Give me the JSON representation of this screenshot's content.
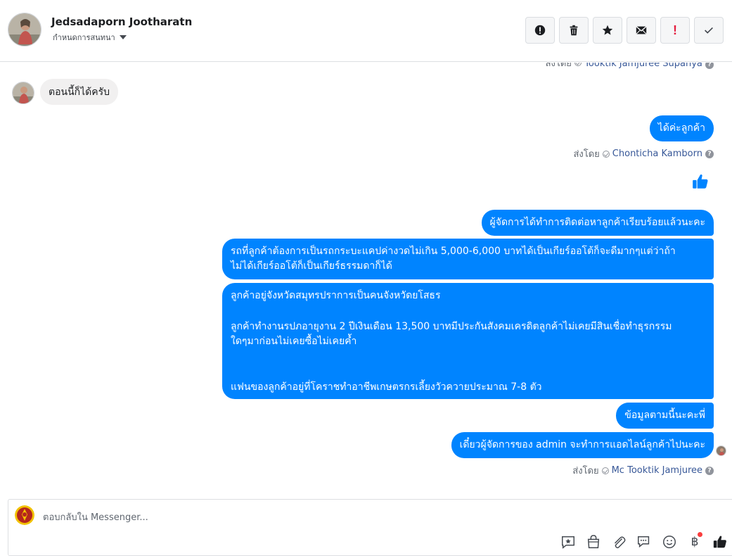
{
  "header": {
    "name": "Jedsadaporn Jootharatn",
    "assign_label": "กำหนดการสนทนา",
    "toolbar_icons": [
      "alert-circle-icon",
      "trash-icon",
      "star-icon",
      "envelope-icon",
      "exclamation-icon",
      "checkmark-icon"
    ]
  },
  "thread": {
    "cutoff_prefix": "ส่งโดย",
    "cutoff_name": "Tooktik Jamjuree Supanya",
    "incoming": "ตอนนี้ก็ได้ครับ",
    "reply1": "ได้ค่ะลูกค้า",
    "sentby_prefix": "ส่งโดย",
    "sentby1_name": "Chonticha Kamborn",
    "msg1": "ผู้จัดการได้ทำการติดต่อหาลูกค้าเรียบร้อยแล้วนะคะ",
    "msg2_l1": "รถที่ลูกค้าต้องการเป็นรถกระบะแคปค่างวดไม่เกิน 5,000-6,000 บาทได้เป็นเกียร์ออโต้ก็จะดีมากๆแต่ว่าถ้า",
    "msg2_l2": "ไม่ได้เกียร์ออโต้ก็เป็นเกียร์ธรรมดาก็ได้",
    "msg3_l1": "ลูกค้าอยู่จังหวัดสมุทรปราการเป็นคนจังหวัดยโสธร",
    "msg3_l2": "ลูกค้าทำงานรปภอายุงาน 2 ปีเงินเดือน 13,500 บาทมีประกันสังคมเครดิตลูกค้าไม่เคยมีสินเชื่อทำธุรกรรม",
    "msg3_l3": "ใดๆมาก่อนไม่เคยซื้อไม่เคยค้ำ",
    "msg3_l4": "แฟนของลูกค้าอยู่ที่โคราชทำอาชีพเกษตรกรเลี้ยงวัวควายประมาณ 7-8 ตัว",
    "msg4": "ข้อมูลตามนี้นะคะพี่",
    "msg5": "เดี๋ยวผู้จัดการของ admin จะทำการแอดไลน์ลูกค้าไปนะคะ",
    "sentby2_name": "Mc Tooktik Jamjuree"
  },
  "composer": {
    "placeholder": "ตอบกลับใน Messenger...",
    "currency_symbol": "฿",
    "tools": [
      "saved-reply-icon",
      "shop-bag-icon",
      "attachment-icon",
      "chat-bubbles-icon",
      "emoji-icon",
      "currency-icon",
      "like-icon"
    ]
  },
  "colors": {
    "accent": "#0084ff",
    "incoming_bubble": "#f1f0f0",
    "notification_dot": "#fa3e3e"
  }
}
